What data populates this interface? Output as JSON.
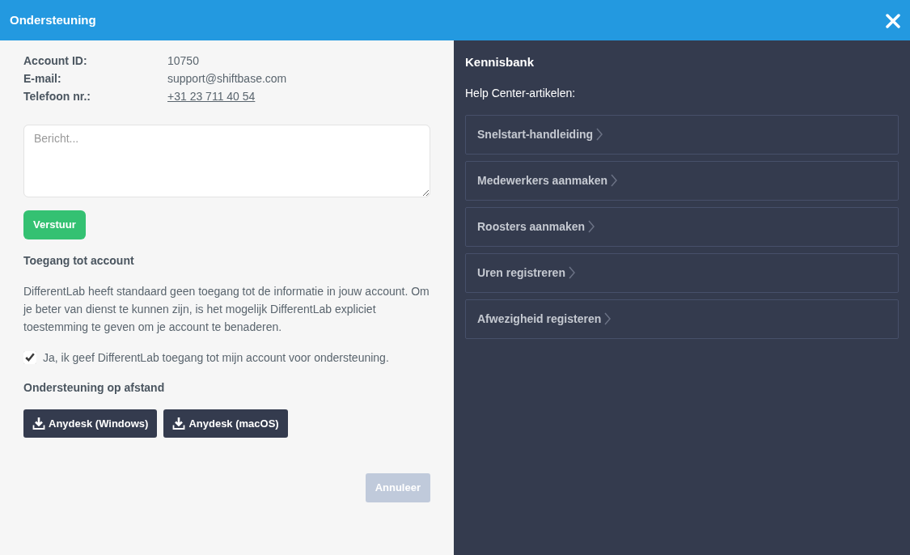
{
  "window": {
    "title": "Ondersteuning"
  },
  "account_info": [
    {
      "label": "Account ID:",
      "value": "10750",
      "kind": "text"
    },
    {
      "label": "E-mail:",
      "value": "support@shiftbase.com",
      "kind": "text"
    },
    {
      "label": "Telefoon nr.:",
      "value": "+31 23 711 40 54",
      "kind": "link"
    }
  ],
  "message": {
    "placeholder": "Bericht..."
  },
  "send_button": "Verstuur",
  "access": {
    "heading": "Toegang tot account",
    "description": "DifferentLab heeft standaard geen toegang tot de informatie in jouw account. Om je beter van dienst te kunnen zijn, is het mogelijk DifferentLab expliciet toestemming te geven om je account te benaderen.",
    "consent": {
      "label": "Ja, ik geef DifferentLab toegang tot mijn account voor ondersteuning.",
      "checked": true
    }
  },
  "remote": {
    "heading": "Ondersteuning op afstand",
    "buttons": [
      "Anydesk (Windows)",
      "Anydesk (macOS)"
    ]
  },
  "cancel_button": {
    "label": "Annuleer",
    "disabled": true
  },
  "knowledge_base": {
    "title": "Kennisbank",
    "subtitle": "Help Center-artikelen:",
    "articles": [
      "Snelstart-handleiding",
      "Medewerkers aanmaken",
      "Roosters aanmaken",
      "Uren registreren",
      "Afwezigheid registeren"
    ]
  }
}
